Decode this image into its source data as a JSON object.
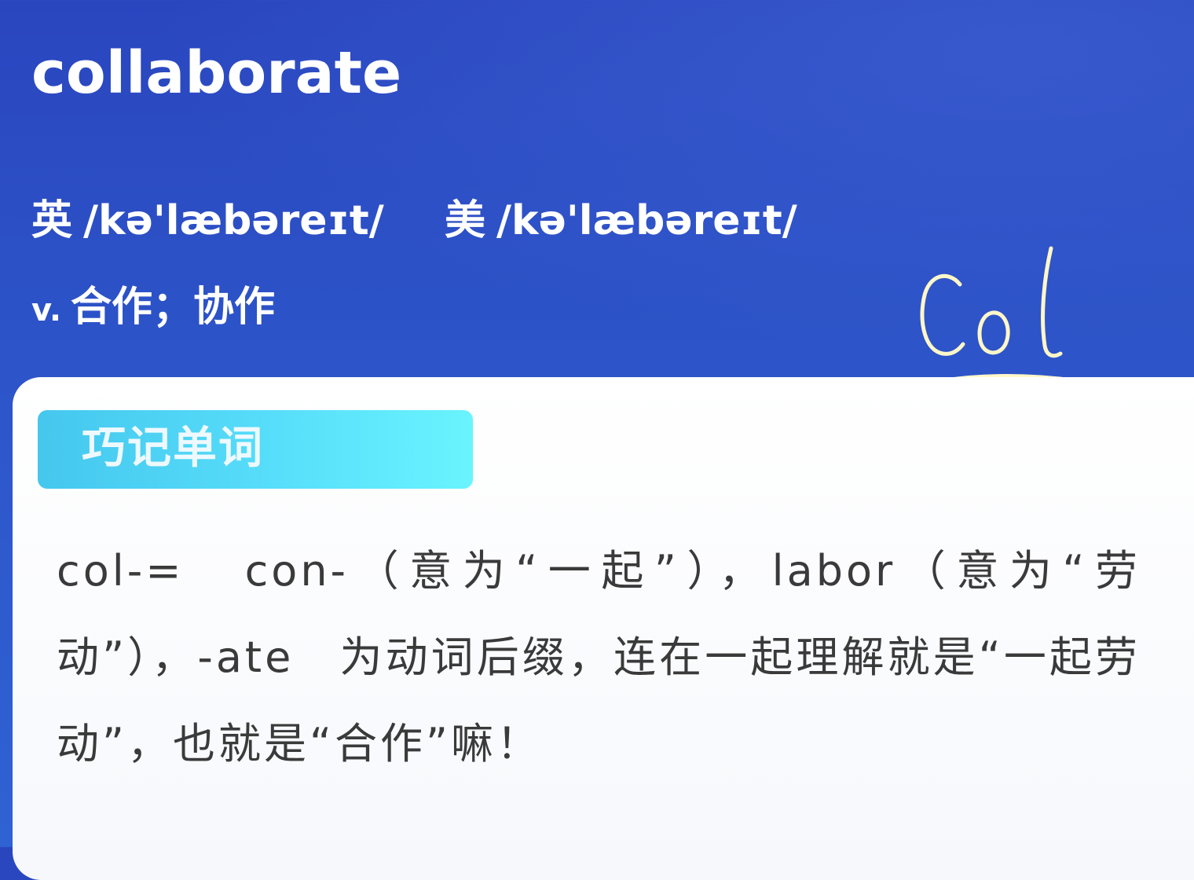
{
  "word": {
    "title": "collaborate",
    "uk_label": "英",
    "uk_phonetic": "/kə'læbəreɪt/",
    "us_label": "美",
    "us_phonetic": "/kə'læbəreɪt/",
    "part_of_speech": "v.",
    "meaning": "合作；协作"
  },
  "handwriting": {
    "text": "Col"
  },
  "memory_card": {
    "header": "巧记单词",
    "body": "col-=　con-（意为“一起”），labor（意为“劳动”），-ate　为动词后缀，连在一起理解就是“一起劳动”，也就是“合作”嘛！"
  },
  "colors": {
    "background": "#2a46bf",
    "card_header": "#57defa",
    "handwriting_stroke": "#fff7c8"
  }
}
